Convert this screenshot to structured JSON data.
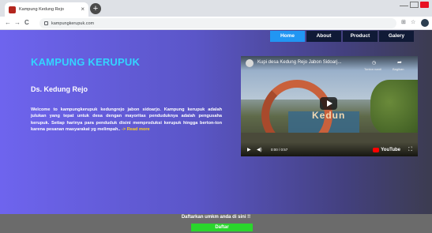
{
  "browser": {
    "tab_title": "Kampung Kedung Rejo",
    "tab_close": "×",
    "new_tab": "+",
    "url": "kampungkerupuk.com",
    "back": "←",
    "forward": "→",
    "reload": "C",
    "translate": "⊞",
    "star": "☆"
  },
  "nav": {
    "items": [
      {
        "label": "Home"
      },
      {
        "label": "About"
      },
      {
        "label": "Product"
      },
      {
        "label": "Galery"
      }
    ]
  },
  "hero": {
    "title": "KAMPUNG KERUPUK",
    "subtitle": "Ds. Kedung Rejo",
    "description": "Welcome to kampungkerupuk kedungrejo jabon sidoarjo. Kampung kerupuk adalah julukan yang tepat untuk desa dengan mayoritas penduduknya adalah pengusaha kerupuk. Setiap harinya para penduduk disini memproduksi kerupuk hingga berton-ton karena pesanan masyarakat yg melimpah..",
    "read_more": " -> Read more"
  },
  "video": {
    "title": "Kupi desa Kedung Rejo Jabon Sidoarj...",
    "watch_later_label": "Tonton nanti",
    "share_label": "Bagikan",
    "sign_text": "Kedun",
    "time": "0:00 / 0:57",
    "brand": "YouTube"
  },
  "footer": {
    "text": "Daftarkan umkm anda di sini !!",
    "button": "Daftar"
  },
  "colors": {
    "title": "#33d4ff",
    "nav_active": "#2196f3",
    "nav_bg": "#101a36",
    "button": "#2ad62c",
    "read_more": "#ffd21f"
  }
}
